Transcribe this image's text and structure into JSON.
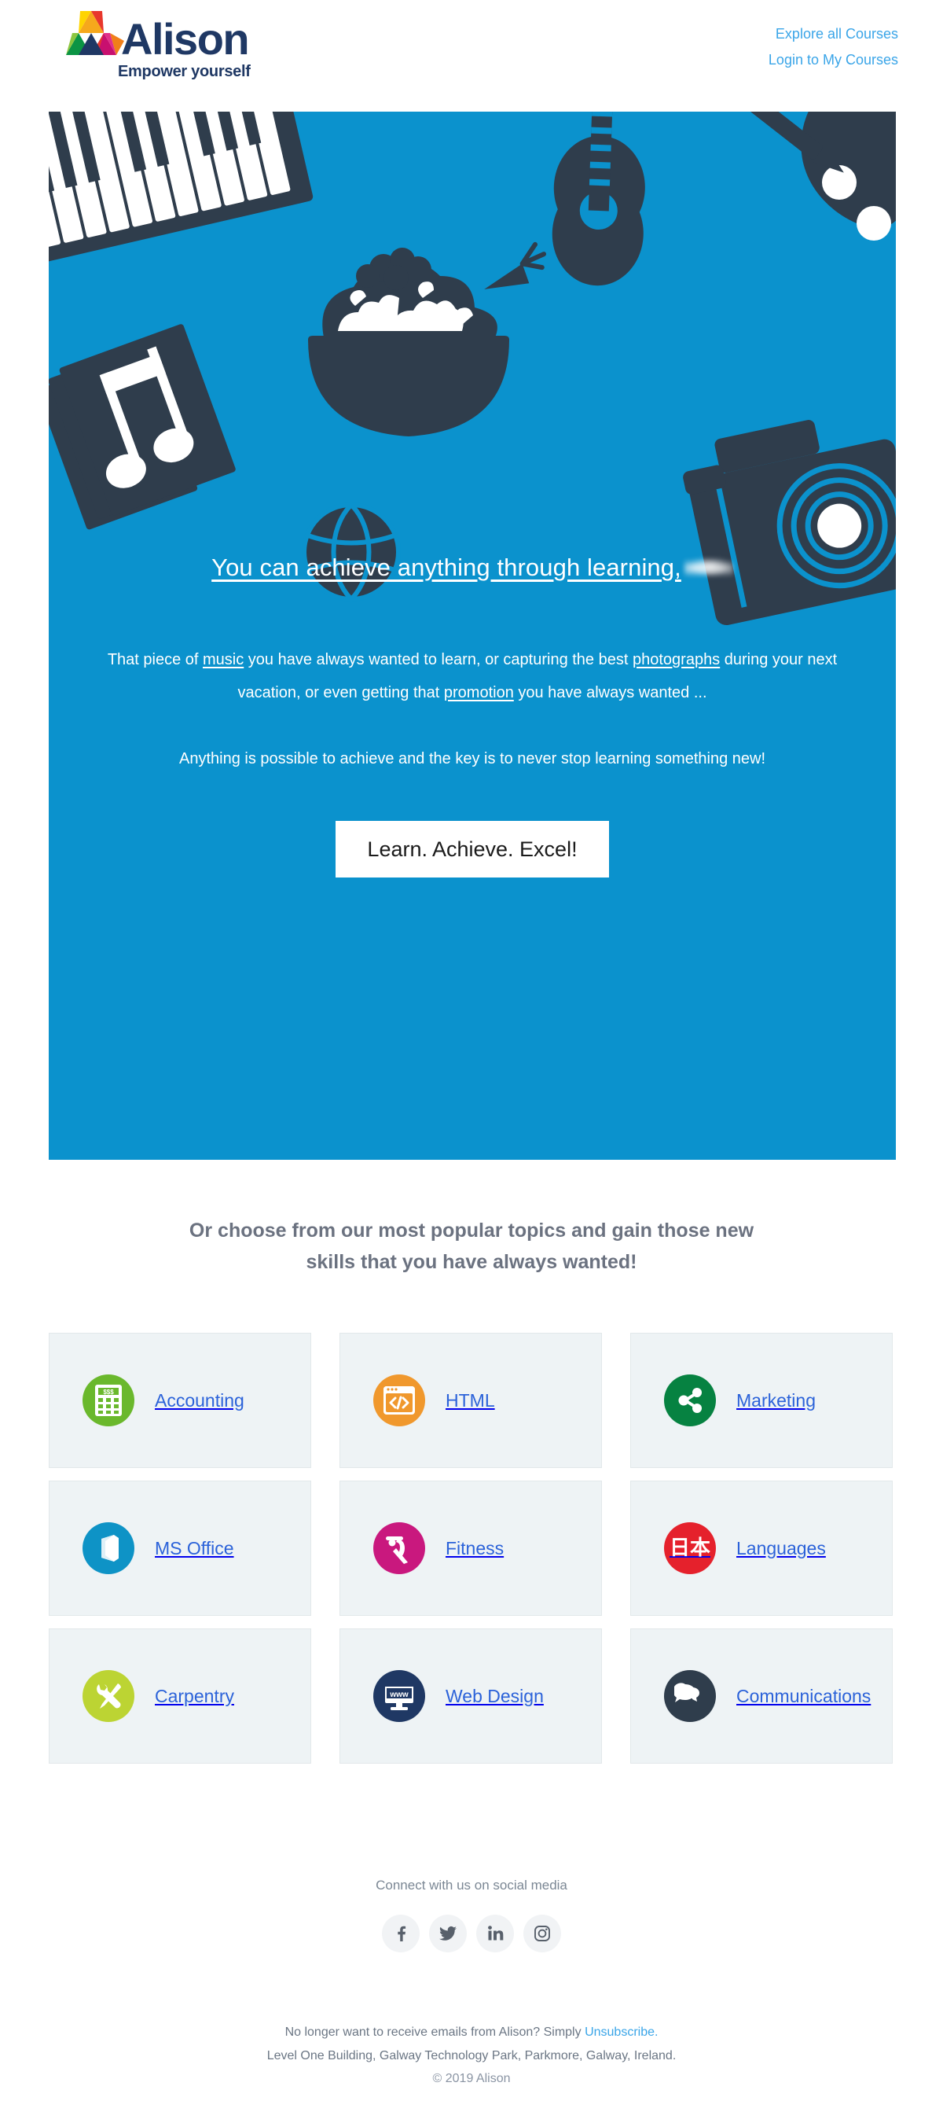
{
  "brand": {
    "name": "Alison",
    "tagline": "Empower yourself",
    "logo_icon": "alison-triangles-logo",
    "logo_colors": [
      "#f6a81c",
      "#e8372c",
      "#c8106f",
      "#e1308a",
      "#f07f1a",
      "#8dc63f",
      "#0b9444",
      "#ffd400",
      "#1f3864"
    ],
    "text_color": "#1f3864"
  },
  "header": {
    "links": [
      {
        "label": "Explore all Courses",
        "name": "explore-all-courses-link"
      },
      {
        "label": "Login to My Courses",
        "name": "login-to-my-courses-link"
      }
    ],
    "link_color": "#3aa5e8"
  },
  "hero": {
    "background_color": "#0b92cd",
    "art_color": "#2f3d4c",
    "illustrations": [
      "piano-keyboard-icon",
      "sheet-music-note-icon",
      "salad-bowl-icon",
      "guitar-icon",
      "paint-palette-icon",
      "basketball-icon",
      "camera-icon"
    ],
    "title_before": "You can achieve anything through learning,",
    "title_redacted": true,
    "paragraph1_parts": [
      {
        "text": "That piece of ",
        "underline": false
      },
      {
        "text": "music",
        "underline": true
      },
      {
        "text": " you have always wanted to learn, or capturing the best ",
        "underline": false
      },
      {
        "text": "photographs",
        "underline": true
      },
      {
        "text": " during your next vacation, or even getting that ",
        "underline": false
      },
      {
        "text": "promotion",
        "underline": true
      },
      {
        "text": " you have always wanted ...",
        "underline": false
      }
    ],
    "paragraph2": "Anything is possible to achieve and the key is to never stop learning something new!",
    "cta_label": "Learn. Achieve. Excel!"
  },
  "topics": {
    "heading": "Or choose from our most popular topics and gain those new skills that you have always wanted!",
    "heading_color": "#6b7280",
    "label_color": "#2b62d9",
    "tile_background": "#eef3f5",
    "items": [
      {
        "label": "Accounting",
        "icon": "calculator-icon",
        "color": "#6ab82c"
      },
      {
        "label": "HTML",
        "icon": "code-window-icon",
        "color": "#f0982d"
      },
      {
        "label": "Marketing",
        "icon": "share-nodes-icon",
        "color": "#068241"
      },
      {
        "label": "MS Office",
        "icon": "ms-office-icon",
        "color": "#0e93c6"
      },
      {
        "label": "Fitness",
        "icon": "stretching-person-icon",
        "color": "#c9187e"
      },
      {
        "label": "Languages",
        "icon": "japanese-kanji-icon",
        "color": "#e5212c",
        "glyph": "日本"
      },
      {
        "label": "Carpentry",
        "icon": "wrench-screwdriver-icon",
        "color": "#bcd433"
      },
      {
        "label": "Web Design",
        "icon": "monitor-www-icon",
        "color": "#1f3864",
        "glyph": "www"
      },
      {
        "label": "Communications",
        "icon": "speech-bubbles-icon",
        "color": "#2f3d4c"
      }
    ]
  },
  "social": {
    "heading": "Connect with us on social media",
    "items": [
      {
        "label": "Facebook",
        "icon": "facebook-icon"
      },
      {
        "label": "Twitter",
        "icon": "twitter-icon"
      },
      {
        "label": "LinkedIn",
        "icon": "linkedin-icon"
      },
      {
        "label": "Instagram",
        "icon": "instagram-icon"
      }
    ]
  },
  "footer": {
    "unsubscribe_prefix": "No longer want to receive emails from Alison? Simply ",
    "unsubscribe_link": "Unsubscribe.",
    "address": "Level One Building, Galway Technology Park, Parkmore, Galway, Ireland.",
    "copyright": "© 2019 Alison"
  }
}
